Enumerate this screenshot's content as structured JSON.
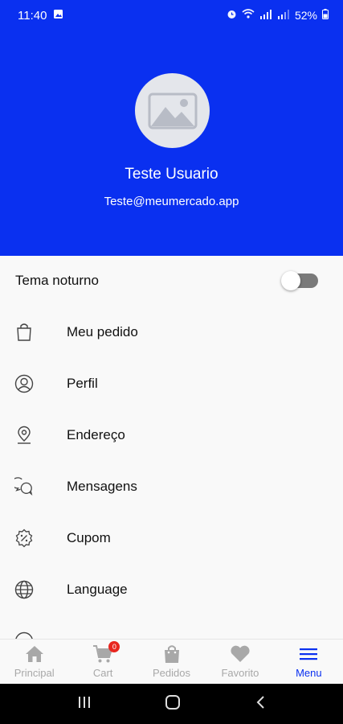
{
  "status_bar": {
    "time": "11:40",
    "battery": "52%"
  },
  "profile": {
    "name": "Teste Usuario",
    "email": "Teste@meumercado.app"
  },
  "theme": {
    "label": "Tema noturno",
    "enabled": false
  },
  "menu": {
    "items": [
      {
        "label": "Meu pedido",
        "icon": "shopping-bag-icon"
      },
      {
        "label": "Perfil",
        "icon": "user-circle-icon"
      },
      {
        "label": "Endereço",
        "icon": "location-pin-icon"
      },
      {
        "label": "Mensagens",
        "icon": "chat-bubbles-icon"
      },
      {
        "label": "Cupom",
        "icon": "coupon-badge-icon"
      },
      {
        "label": "Language",
        "icon": "globe-icon"
      }
    ]
  },
  "bottom_nav": {
    "tabs": [
      {
        "label": "Principal",
        "icon": "home-icon",
        "active": false
      },
      {
        "label": "Cart",
        "icon": "cart-icon",
        "active": false,
        "badge": "0"
      },
      {
        "label": "Pedidos",
        "icon": "bag-icon",
        "active": false
      },
      {
        "label": "Favorito",
        "icon": "heart-icon",
        "active": false
      },
      {
        "label": "Menu",
        "icon": "menu-icon",
        "active": true
      }
    ]
  },
  "colors": {
    "primary": "#0a30f0",
    "inactive": "#a8a8a8",
    "badge": "#e8261f"
  }
}
